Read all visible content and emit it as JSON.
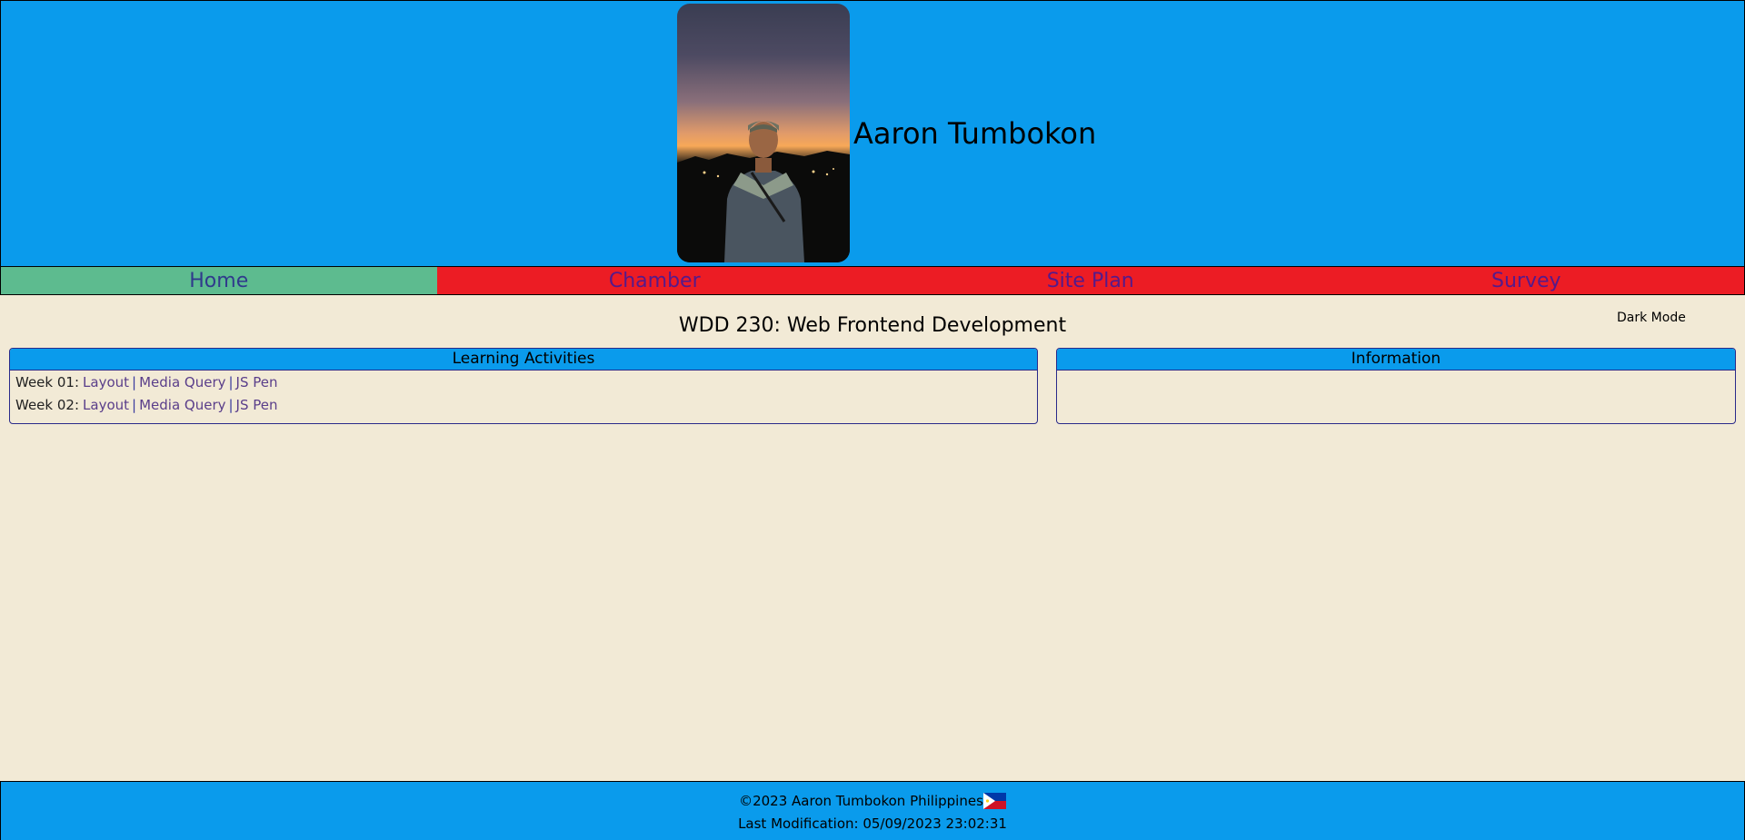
{
  "header": {
    "name": "Aaron Tumbokon"
  },
  "nav": {
    "items": [
      {
        "label": "Home"
      },
      {
        "label": "Chamber"
      },
      {
        "label": "Site Plan"
      },
      {
        "label": "Survey"
      }
    ],
    "active": "Home"
  },
  "main": {
    "title": "WDD 230: Web Frontend Development",
    "dark_mode_label": "Dark Mode",
    "learning": {
      "heading": "Learning Activities",
      "weeks": [
        {
          "label": "Week 01:",
          "links": [
            "Layout",
            "Media Query",
            "JS Pen"
          ]
        },
        {
          "label": "Week 02:",
          "links": [
            "Layout",
            "Media Query",
            "JS Pen"
          ]
        }
      ]
    },
    "information": {
      "heading": "Information"
    }
  },
  "footer": {
    "copyright": "©2023 Aaron Tumbokon Philippines",
    "last_modified": "Last Modification: 05/09/2023 23:02:31"
  },
  "colors": {
    "header_bg": "#0a9bec",
    "page_bg": "#f2ead6",
    "nav_active": "#5dbb8f",
    "nav_inactive": "#ec1c24"
  }
}
